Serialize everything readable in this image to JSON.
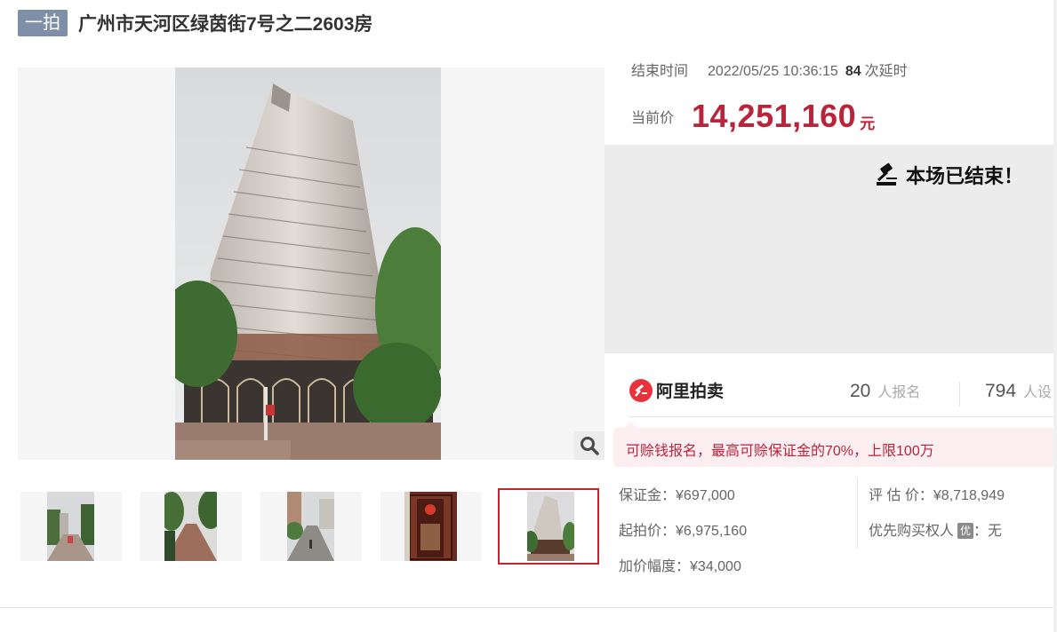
{
  "header": {
    "round_badge": "一拍",
    "title": "广州市天河区绿茵街7号之二2603房"
  },
  "gallery": {
    "main_image": "building-photo",
    "zoom_icon": "magnifier-icon",
    "thumbnails": [
      {
        "name": "street-photo-1",
        "selected": false
      },
      {
        "name": "street-photo-2",
        "selected": false
      },
      {
        "name": "street-photo-3",
        "selected": false
      },
      {
        "name": "door-photo",
        "selected": false
      },
      {
        "name": "building-photo",
        "selected": true
      }
    ]
  },
  "auction": {
    "end_label": "结束时间",
    "end_time": "2022/05/25 10:36:15",
    "delay_count": "84",
    "delay_label": "次延时",
    "price_label": "当前价",
    "price_value": "14,251,160",
    "price_unit": "元",
    "ended_notice": "本场已结束！"
  },
  "stats": {
    "platform": "阿里拍卖",
    "signups_count": "20",
    "signups_label": "人报名",
    "reminders_count": "794",
    "reminders_label": "人设"
  },
  "promo": {
    "text": "可赊钱报名，最高可赊保证金的70%，上限100万"
  },
  "details": {
    "deposit_label": "保证金：",
    "deposit_value": "¥697,000",
    "start_label": "起拍价：",
    "start_value": "¥6,975,160",
    "increment_label": "加价幅度：",
    "increment_value": "¥34,000",
    "appraisal_label": "评 估 价：",
    "appraisal_value": "¥8,718,949",
    "preemption_label": "优先购买权人",
    "preemption_badge": "优",
    "preemption_value": "：无"
  },
  "colors": {
    "accent": "#b9243b",
    "badge": "#7e8fa8",
    "selected_border": "#c8232c"
  }
}
